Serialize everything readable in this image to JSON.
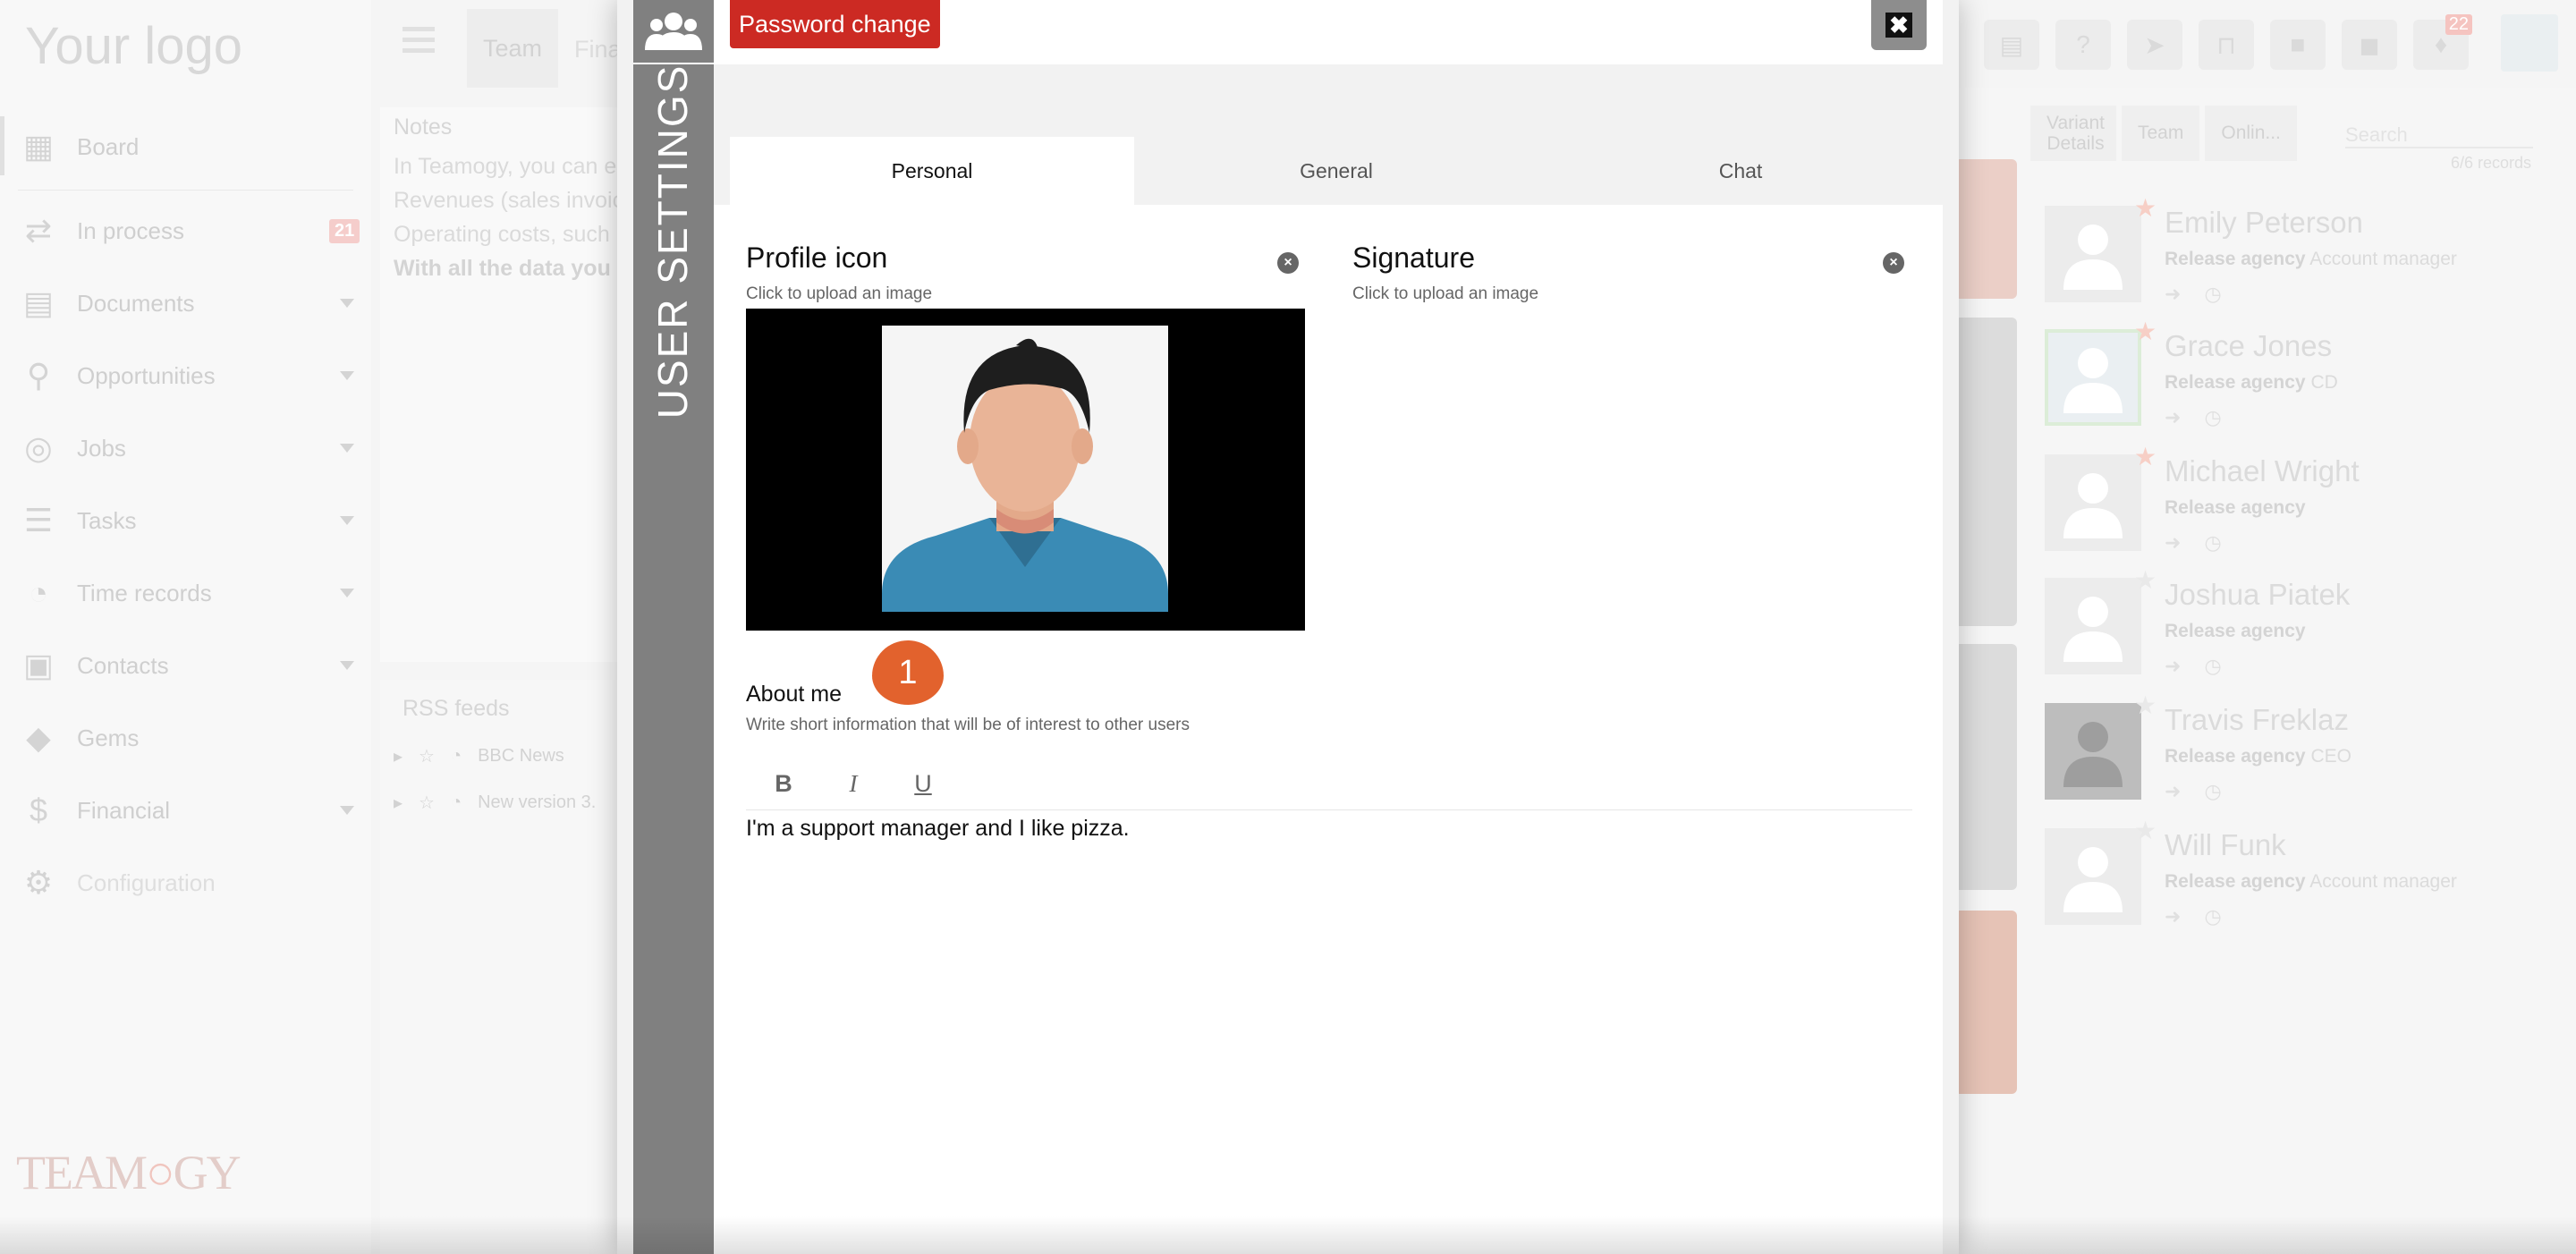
{
  "app": {
    "logo": "Your logo",
    "brand_logo": "TEAMOGY"
  },
  "sidebar": {
    "items": [
      {
        "label": "Board",
        "icon": "board-icon",
        "caret": false
      },
      {
        "label": "In process",
        "icon": "process-icon",
        "caret": false,
        "badge": "21"
      },
      {
        "label": "Documents",
        "icon": "document-icon",
        "caret": true
      },
      {
        "label": "Opportunities",
        "icon": "opportunity-icon",
        "caret": true
      },
      {
        "label": "Jobs",
        "icon": "target-icon",
        "caret": true
      },
      {
        "label": "Tasks",
        "icon": "tasks-icon",
        "caret": true
      },
      {
        "label": "Time records",
        "icon": "clock-icon",
        "caret": true
      },
      {
        "label": "Contacts",
        "icon": "contacts-icon",
        "caret": true
      },
      {
        "label": "Gems",
        "icon": "gem-icon",
        "caret": false
      },
      {
        "label": "Financial",
        "icon": "dollar-icon",
        "caret": true
      },
      {
        "label": "Configuration",
        "icon": "gear-icon",
        "caret": false
      }
    ]
  },
  "topbar": {
    "tab_team": "Team",
    "tab_fina": "Fina",
    "notification_count": "22"
  },
  "notes": {
    "title": "Notes",
    "lines": [
      "In Teamogy, you can e",
      "Revenues (sales invoic",
      "Operating costs, such",
      "With all the data you n"
    ]
  },
  "rss": {
    "title": "RSS feeds",
    "items": [
      "BBC News",
      "New version 3."
    ]
  },
  "right_panel": {
    "breadcrumb": [
      "Variant Details",
      "Team",
      "Onlin..."
    ],
    "search_placeholder": "Search",
    "records": "6/6 records",
    "people": [
      {
        "name": "Emily Peterson",
        "agency": "Release agency",
        "role": "Account manager",
        "starred": true
      },
      {
        "name": "Grace Jones",
        "agency": "Release agency",
        "role": "CD",
        "starred": true
      },
      {
        "name": "Michael Wright",
        "agency": "Release agency",
        "role": "",
        "starred": true
      },
      {
        "name": "Joshua Piatek",
        "agency": "Release agency",
        "role": "",
        "starred": false
      },
      {
        "name": "Travis Freklaz",
        "agency": "Release agency",
        "role": "CEO",
        "starred": false
      },
      {
        "name": "Will Funk",
        "agency": "Release agency",
        "role": "Account manager",
        "starred": false
      }
    ]
  },
  "modal": {
    "side_title": "USER SETTINGS",
    "password_button": "Password change",
    "close_label": "✖",
    "tabs": [
      "Personal",
      "General",
      "Chat"
    ],
    "active_tab": "Personal",
    "profile_icon": {
      "title": "Profile icon",
      "subtitle": "Click to upload an image"
    },
    "signature": {
      "title": "Signature",
      "subtitle": "Click to upload an image"
    },
    "about": {
      "title": "About me",
      "subtitle": "Write short information that will be of interest to other users",
      "text": "I'm a support manager and I like pizza."
    },
    "toolbar": {
      "bold": "B",
      "italic": "I",
      "underline": "U"
    },
    "step_badge": "1"
  },
  "colors": {
    "accent_red": "#cc2a23",
    "step_orange": "#e2622d",
    "modal_side": "#808080"
  }
}
